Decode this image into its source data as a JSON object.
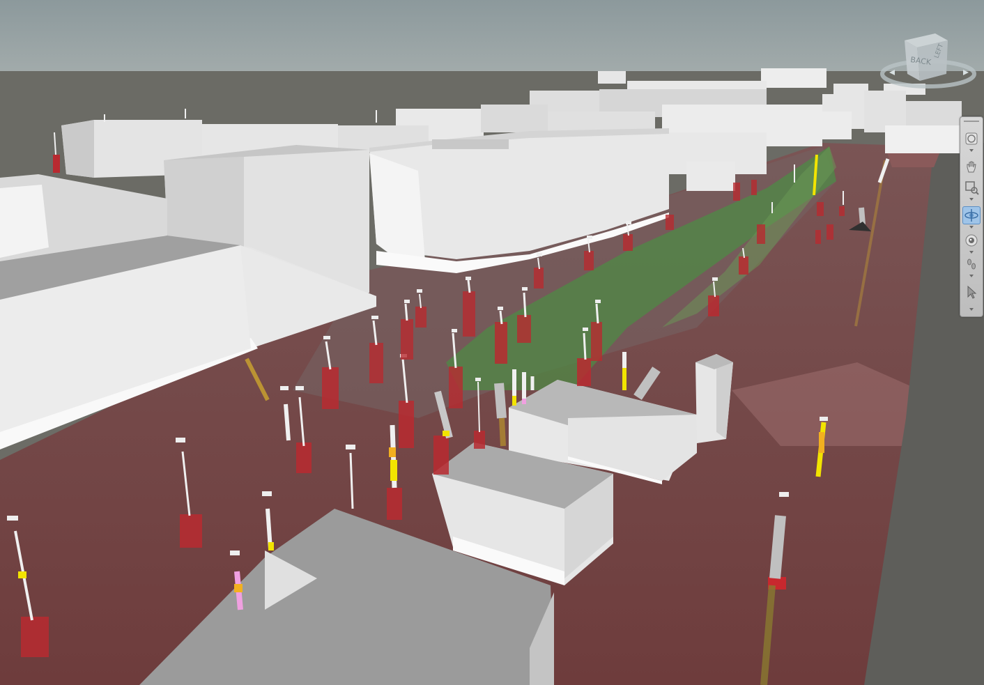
{
  "viewcube": {
    "face_back": "BACK",
    "face_side": "LEFT"
  },
  "nav_bar": {
    "tools": [
      {
        "name": "full-navigation-wheel",
        "icon": "steering-wheel-icon",
        "active": false
      },
      {
        "name": "pan",
        "icon": "hand-icon",
        "active": false
      },
      {
        "name": "zoom-window",
        "icon": "zoom-window-icon",
        "active": false
      },
      {
        "name": "orbit",
        "icon": "orbit-icon",
        "active": true
      },
      {
        "name": "look-around",
        "icon": "eye-icon",
        "active": false
      },
      {
        "name": "walk",
        "icon": "footsteps-icon",
        "active": false
      },
      {
        "name": "select",
        "icon": "cursor-arrow-icon",
        "active": false
      }
    ]
  },
  "colors": {
    "sky": "#8e9a9c",
    "horizon": "#707068",
    "ground_red": "#8a5555",
    "corridor_green": "#5a8a4a",
    "building_light": "#e4e4e4",
    "building_dark": "#9a9a9a",
    "borehole_red": "#c8282e",
    "borehole_yellow": "#f2e400",
    "borehole_pink": "#f0a0e0"
  }
}
